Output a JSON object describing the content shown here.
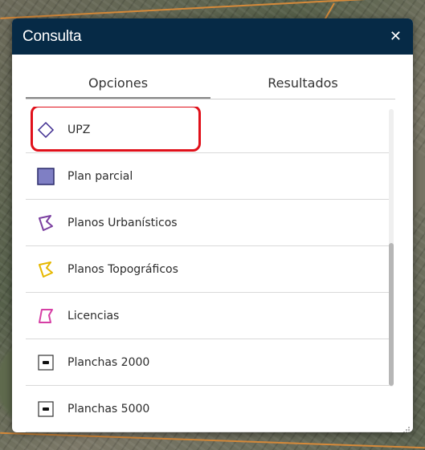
{
  "dialog": {
    "title": "Consulta",
    "close_symbol": "✕"
  },
  "tabs": [
    {
      "label": "Opciones",
      "active": true
    },
    {
      "label": "Resultados",
      "active": false
    }
  ],
  "items": [
    {
      "label": "UPZ",
      "icon": "diamond-outline-icon",
      "highlighted": true
    },
    {
      "label": "Plan parcial",
      "icon": "filled-square-icon"
    },
    {
      "label": "Planos Urbanísticos",
      "icon": "purple-polygon-icon"
    },
    {
      "label": "Planos Topográficos",
      "icon": "yellow-polygon-icon"
    },
    {
      "label": "Licencias",
      "icon": "pink-polygon-icon"
    },
    {
      "label": "Planchas 2000",
      "icon": "sheet-square-icon"
    },
    {
      "label": "Planchas 5000",
      "icon": "sheet-square-icon"
    }
  ],
  "colors": {
    "header_bg": "#062a46",
    "highlight": "#e0101a",
    "upz": "#3d2b8f",
    "plan_parcial": "#7f7fc4",
    "urbanisticos": "#7b3fa0",
    "topograficos": "#e6b800",
    "licencias": "#d63fa5"
  }
}
